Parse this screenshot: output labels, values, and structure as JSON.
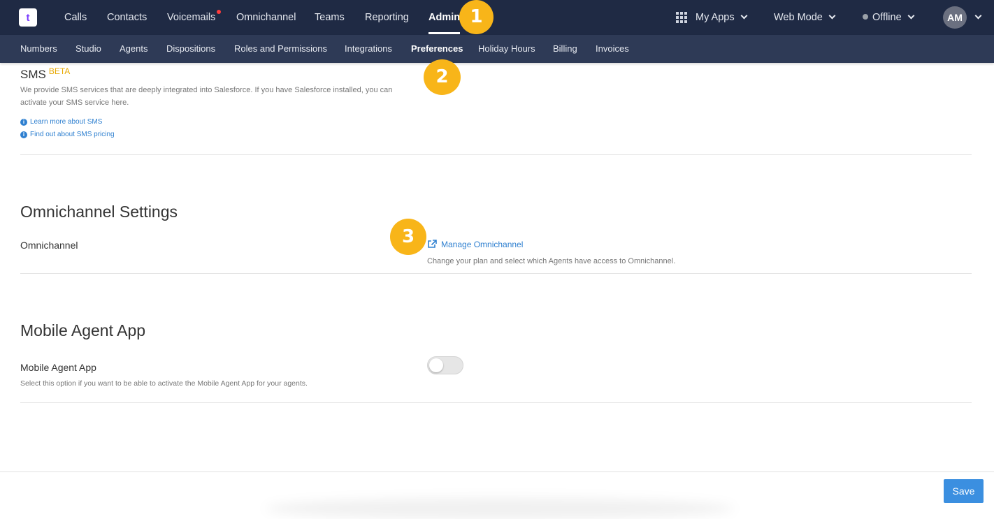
{
  "topnav": {
    "logo": "t",
    "items": [
      {
        "label": "Calls"
      },
      {
        "label": "Contacts"
      },
      {
        "label": "Voicemails"
      },
      {
        "label": "Omnichannel"
      },
      {
        "label": "Teams"
      },
      {
        "label": "Reporting"
      },
      {
        "label": "Admin"
      }
    ],
    "my_apps": "My Apps",
    "web_mode": "Web Mode",
    "status": "Offline",
    "avatar": "AM"
  },
  "subnav": {
    "items": [
      {
        "label": "Numbers"
      },
      {
        "label": "Studio"
      },
      {
        "label": "Agents"
      },
      {
        "label": "Dispositions"
      },
      {
        "label": "Roles and Permissions"
      },
      {
        "label": "Integrations"
      },
      {
        "label": "Preferences"
      },
      {
        "label": "Holiday Hours"
      },
      {
        "label": "Billing"
      },
      {
        "label": "Invoices"
      }
    ]
  },
  "sms": {
    "title": "SMS",
    "badge": "BETA",
    "description": "We provide SMS services that are deeply integrated into Salesforce. If you have Salesforce installed, you can activate your SMS service here.",
    "link_learn": "Learn more about SMS",
    "link_pricing": "Find out about SMS pricing"
  },
  "omnichannel": {
    "section_title": "Omnichannel Settings",
    "row_label": "Omnichannel",
    "manage_link": "Manage Omnichannel",
    "manage_desc": "Change your plan and select which Agents have access to Omnichannel."
  },
  "mobile": {
    "section_title": "Mobile Agent App",
    "row_label": "Mobile Agent App",
    "row_desc": "Select this option if you want to be able to activate the Mobile Agent App for your agents.",
    "enabled": false
  },
  "footer": {
    "save_label": "Save"
  },
  "callouts": [
    "1",
    "2",
    "3"
  ],
  "colors": {
    "topnav": "#1f2a44",
    "subnav": "#2e3a56",
    "accent": "#3b8fe0",
    "callout": "#f8b519",
    "beta": "#e8a800"
  }
}
